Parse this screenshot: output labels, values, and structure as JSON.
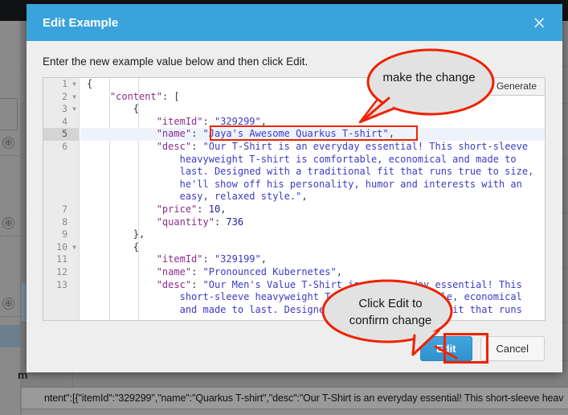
{
  "background": {
    "json_strip": "ntent\":[{\"itemId\":\"329299\",\"name\":\"Quarkus T-shirt\",\"desc\":\"Our T-Shirt is an everyday essential! This short-sleeve heav",
    "partial_label": "m",
    "plus_icon": "⊕"
  },
  "modal": {
    "title": "Edit Example",
    "close_label": "×",
    "instruction": "Enter the new example value below and then click Edit.",
    "generate_label": "Generate",
    "primary_button": "Edit",
    "secondary_button": "Cancel",
    "header_color": "#3ba3db",
    "primary_color": "#3498d8"
  },
  "editor": {
    "active_line": 5,
    "fold_lines": [
      1,
      2,
      3,
      10
    ],
    "line_numbers": [
      "1",
      "2",
      "3",
      "4",
      "5",
      "6",
      "7",
      "8",
      "9",
      "10",
      "11",
      "12",
      "13"
    ],
    "lines": [
      {
        "num": "1",
        "fold": true,
        "segments": [
          {
            "t": "{",
            "c": "tok-punc"
          }
        ]
      },
      {
        "num": "2",
        "fold": true,
        "segments": [
          {
            "t": "    ",
            "c": "tok-punc"
          },
          {
            "t": "\"content\"",
            "c": "tok-key"
          },
          {
            "t": ": [",
            "c": "tok-punc"
          }
        ]
      },
      {
        "num": "3",
        "fold": true,
        "segments": [
          {
            "t": "        {",
            "c": "tok-punc"
          }
        ]
      },
      {
        "num": "4",
        "fold": false,
        "segments": [
          {
            "t": "            ",
            "c": "tok-punc"
          },
          {
            "t": "\"itemId\"",
            "c": "tok-key"
          },
          {
            "t": ": ",
            "c": "tok-punc"
          },
          {
            "t": "\"329299\"",
            "c": "tok-str"
          },
          {
            "t": ",",
            "c": "tok-punc"
          }
        ]
      },
      {
        "num": "5",
        "fold": false,
        "segments": [
          {
            "t": "            ",
            "c": "tok-punc"
          },
          {
            "t": "\"name\"",
            "c": "tok-key"
          },
          {
            "t": ": ",
            "c": "tok-punc"
          },
          {
            "t": "\"Jaya's Awesome Quarkus T-shirt\"",
            "c": "tok-str"
          },
          {
            "t": ",",
            "c": "tok-punc"
          }
        ]
      },
      {
        "num": "6",
        "fold": false,
        "segments": [
          {
            "t": "            ",
            "c": "tok-punc"
          },
          {
            "t": "\"desc\"",
            "c": "tok-key"
          },
          {
            "t": ": ",
            "c": "tok-punc"
          },
          {
            "t": "\"Our T-Shirt is an everyday essential! This short-sleeve",
            "c": "tok-str"
          }
        ]
      },
      {
        "num": "",
        "fold": false,
        "segments": [
          {
            "t": "                heavyweight T-shirt is comfortable, economical and made to",
            "c": "tok-str"
          }
        ]
      },
      {
        "num": "",
        "fold": false,
        "segments": [
          {
            "t": "                last. Designed with a traditional fit that runs true to size,",
            "c": "tok-str"
          }
        ]
      },
      {
        "num": "",
        "fold": false,
        "segments": [
          {
            "t": "                he'll show off his personality, humor and interests with an",
            "c": "tok-str"
          }
        ]
      },
      {
        "num": "",
        "fold": false,
        "segments": [
          {
            "t": "                easy, relaxed style.\"",
            "c": "tok-str"
          },
          {
            "t": ",",
            "c": "tok-punc"
          }
        ]
      },
      {
        "num": "7",
        "fold": false,
        "segments": [
          {
            "t": "            ",
            "c": "tok-punc"
          },
          {
            "t": "\"price\"",
            "c": "tok-key"
          },
          {
            "t": ": ",
            "c": "tok-punc"
          },
          {
            "t": "10",
            "c": "tok-num"
          },
          {
            "t": ",",
            "c": "tok-punc"
          }
        ]
      },
      {
        "num": "8",
        "fold": false,
        "segments": [
          {
            "t": "            ",
            "c": "tok-punc"
          },
          {
            "t": "\"quantity\"",
            "c": "tok-key"
          },
          {
            "t": ": ",
            "c": "tok-punc"
          },
          {
            "t": "736",
            "c": "tok-num"
          }
        ]
      },
      {
        "num": "9",
        "fold": false,
        "segments": [
          {
            "t": "        },",
            "c": "tok-punc"
          }
        ]
      },
      {
        "num": "10",
        "fold": true,
        "segments": [
          {
            "t": "        {",
            "c": "tok-punc"
          }
        ]
      },
      {
        "num": "11",
        "fold": false,
        "segments": [
          {
            "t": "            ",
            "c": "tok-punc"
          },
          {
            "t": "\"itemId\"",
            "c": "tok-key"
          },
          {
            "t": ": ",
            "c": "tok-punc"
          },
          {
            "t": "\"329199\"",
            "c": "tok-str"
          },
          {
            "t": ",",
            "c": "tok-punc"
          }
        ]
      },
      {
        "num": "12",
        "fold": false,
        "segments": [
          {
            "t": "            ",
            "c": "tok-punc"
          },
          {
            "t": "\"name\"",
            "c": "tok-key"
          },
          {
            "t": ": ",
            "c": "tok-punc"
          },
          {
            "t": "\"Pronounced Kubernetes\"",
            "c": "tok-str"
          },
          {
            "t": ",",
            "c": "tok-punc"
          }
        ]
      },
      {
        "num": "13",
        "fold": false,
        "segments": [
          {
            "t": "            ",
            "c": "tok-punc"
          },
          {
            "t": "\"desc\"",
            "c": "tok-key"
          },
          {
            "t": ": ",
            "c": "tok-punc"
          },
          {
            "t": "\"Our Men's Value T-Shirt is an everyday essential! This",
            "c": "tok-str"
          }
        ]
      },
      {
        "num": "",
        "fold": false,
        "segments": [
          {
            "t": "                short-sleeve heavyweight T-shirt is comfortable, economical",
            "c": "tok-str"
          }
        ]
      },
      {
        "num": "",
        "fold": false,
        "segments": [
          {
            "t": "                and made to last. Designed with a traditional fit that runs",
            "c": "tok-str"
          }
        ]
      }
    ]
  },
  "annotations": {
    "callout_make_change": "make the change",
    "callout_click_edit_line1": "Click Edit to",
    "callout_click_edit_line2": "confirm change",
    "highlight_color": "#ee2200",
    "callout_fill": "#e2e2e2"
  }
}
